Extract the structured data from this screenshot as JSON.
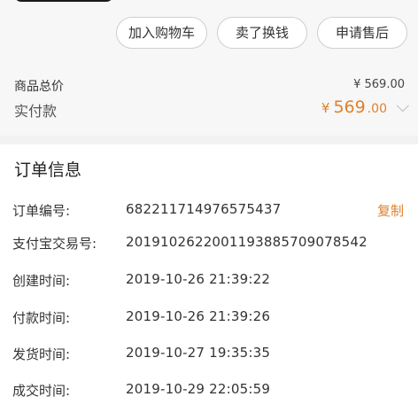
{
  "actions": {
    "add_to_cart": "加入购物车",
    "sell_for_cash": "卖了换钱",
    "after_sales": "申请售后"
  },
  "summary": {
    "total_label": "商品总价",
    "total_value": "¥ 569.00",
    "paid_label": "实付款",
    "paid_currency": "¥",
    "paid_amount": "569",
    "paid_decimal": ".00"
  },
  "order_info": {
    "title": "订单信息",
    "copy_label": "复制",
    "rows": [
      {
        "label": "订单编号:",
        "value": "682211714976575437"
      },
      {
        "label": "支付宝交易号:",
        "value": "2019102622001193885709078542"
      },
      {
        "label": "创建时间:",
        "value": "2019-10-26 21:39:22"
      },
      {
        "label": "付款时间:",
        "value": "2019-10-26 21:39:26"
      },
      {
        "label": "发货时间:",
        "value": "2019-10-27 19:35:35"
      },
      {
        "label": "成交时间:",
        "value": "2019-10-29 22:05:59"
      }
    ]
  },
  "colors": {
    "accent": "#e0812b",
    "background": "#f2f2f2",
    "card": "#ffffff"
  },
  "icons": {
    "paid_expand": "chevron-down-icon"
  }
}
